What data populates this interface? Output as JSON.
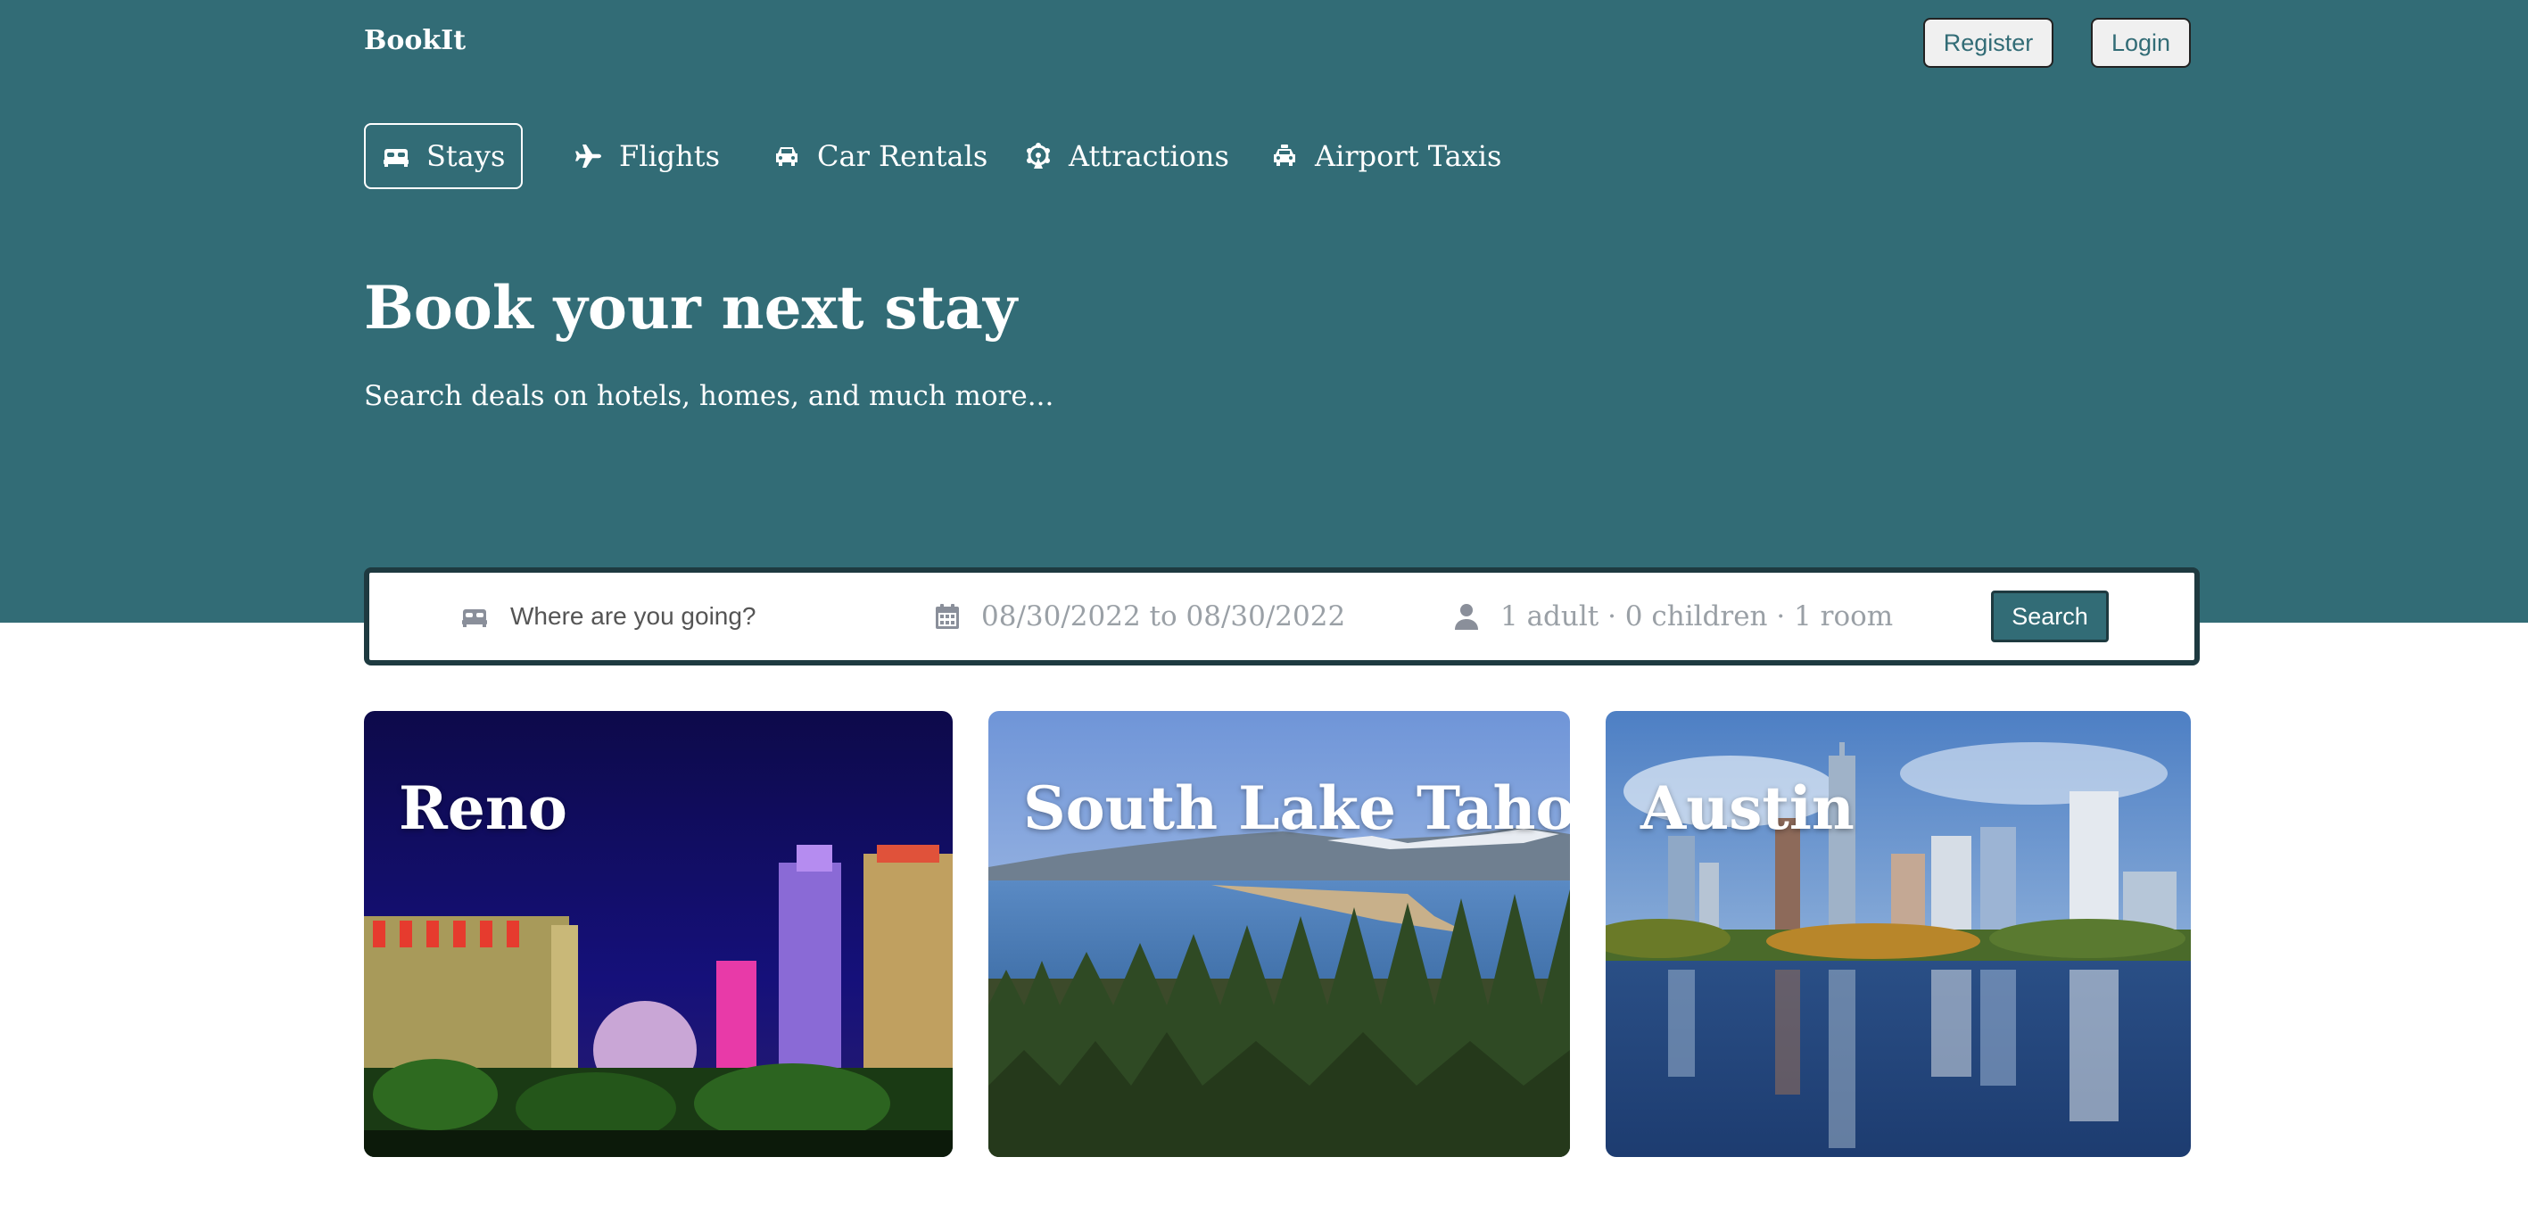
{
  "brand": {
    "name": "BookIt",
    "accent": "#326c76",
    "dark": "#1e3a40"
  },
  "auth": {
    "register_label": "Register",
    "login_label": "Login"
  },
  "nav": {
    "items": [
      {
        "label": "Stays",
        "icon": "bed-icon",
        "active": true
      },
      {
        "label": "Flights",
        "icon": "plane-icon",
        "active": false
      },
      {
        "label": "Car Rentals",
        "icon": "car-icon",
        "active": false
      },
      {
        "label": "Attractions",
        "icon": "ferris-wheel-icon",
        "active": false
      },
      {
        "label": "Airport Taxis",
        "icon": "taxi-icon",
        "active": false
      }
    ]
  },
  "hero": {
    "title": "Book your next stay",
    "subtitle": "Search deals on hotels, homes, and much more..."
  },
  "search": {
    "destination_placeholder": "Where are you going?",
    "dates": "08/30/2022 to 08/30/2022",
    "guests": "1 adult · 0 children · 1 room",
    "button_label": "Search"
  },
  "destinations": [
    {
      "name": "Reno",
      "image": "reno-night-skyline"
    },
    {
      "name": "South Lake Tahoe",
      "image": "lake-tahoe-forest"
    },
    {
      "name": "Austin",
      "image": "austin-skyline-reflection"
    }
  ]
}
